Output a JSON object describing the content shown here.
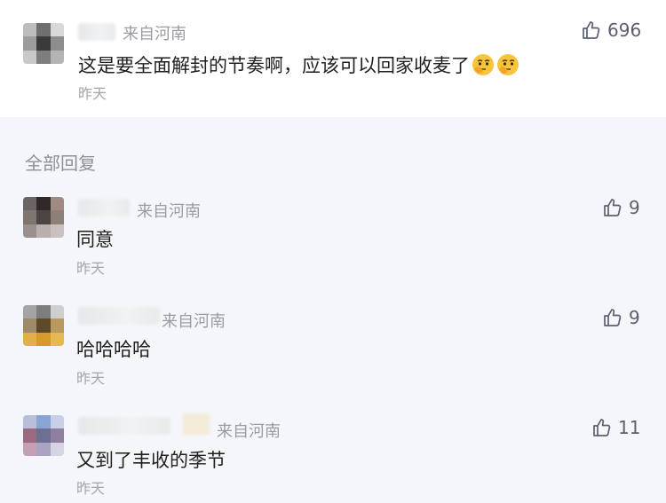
{
  "main_comment": {
    "origin": "来自河南",
    "text": "这是要全面解封的节奏啊，应该可以回家收麦了",
    "emoji_count": 2,
    "emoji_icon": "thinking-face-emoji",
    "time": "昨天",
    "likes": "696"
  },
  "replies_header": "全部回复",
  "replies": [
    {
      "origin": "来自河南",
      "text": "同意",
      "time": "昨天",
      "likes": "9"
    },
    {
      "origin": "来自河南",
      "text": "哈哈哈哈",
      "time": "昨天",
      "likes": "9"
    },
    {
      "origin": "来自河南",
      "text": "又到了丰收的季节",
      "time": "昨天",
      "likes": "11"
    }
  ],
  "colors": {
    "page_bg": "#f5f6fa",
    "card_bg": "#ffffff",
    "secondary_text": "#9a9ca3",
    "like_icon": "#5b6070"
  }
}
